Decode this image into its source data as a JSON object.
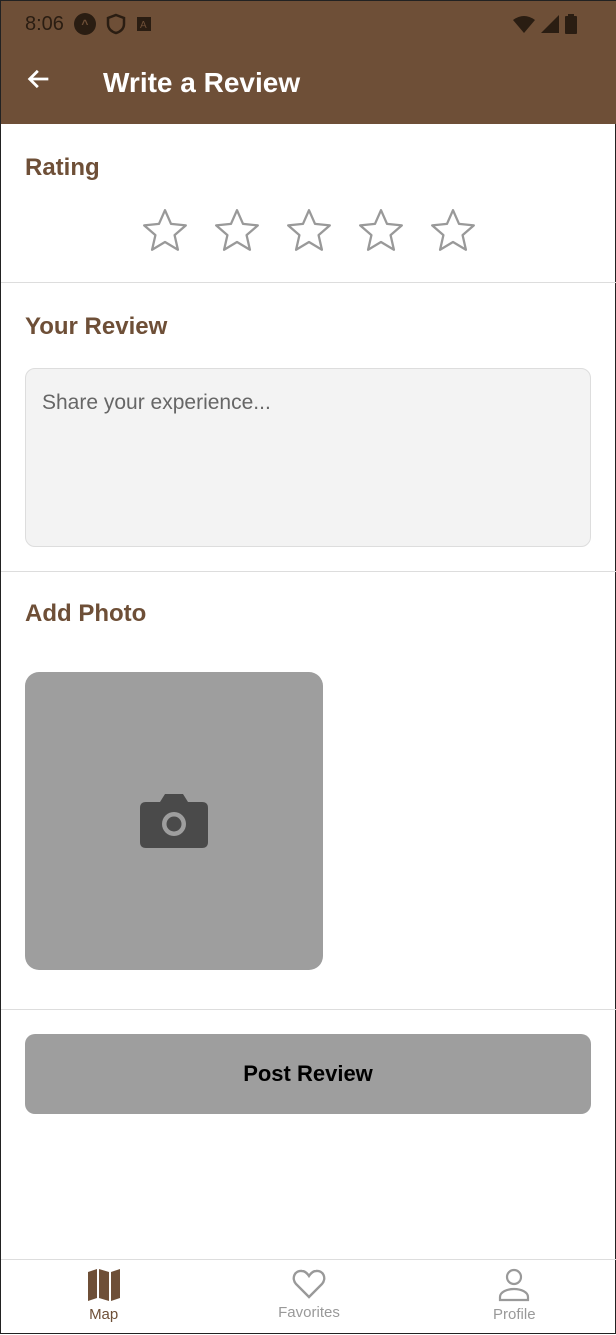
{
  "status_bar": {
    "time": "8:06"
  },
  "header": {
    "title": "Write a Review",
    "back_icon": "arrow-left-icon"
  },
  "rating": {
    "label": "Rating",
    "max_stars": 5,
    "value": 0
  },
  "review": {
    "label": "Your Review",
    "placeholder": "Share your experience...",
    "value": ""
  },
  "photo": {
    "label": "Add Photo",
    "icon": "camera-icon"
  },
  "post_button": {
    "label": "Post Review"
  },
  "colors": {
    "brand": "#6e4f37",
    "disabled": "#9e9e9e"
  },
  "bottom_nav": {
    "items": [
      {
        "label": "Map",
        "icon": "map-icon",
        "active": true
      },
      {
        "label": "Favorites",
        "icon": "heart-icon",
        "active": false
      },
      {
        "label": "Profile",
        "icon": "person-icon",
        "active": false
      }
    ]
  }
}
